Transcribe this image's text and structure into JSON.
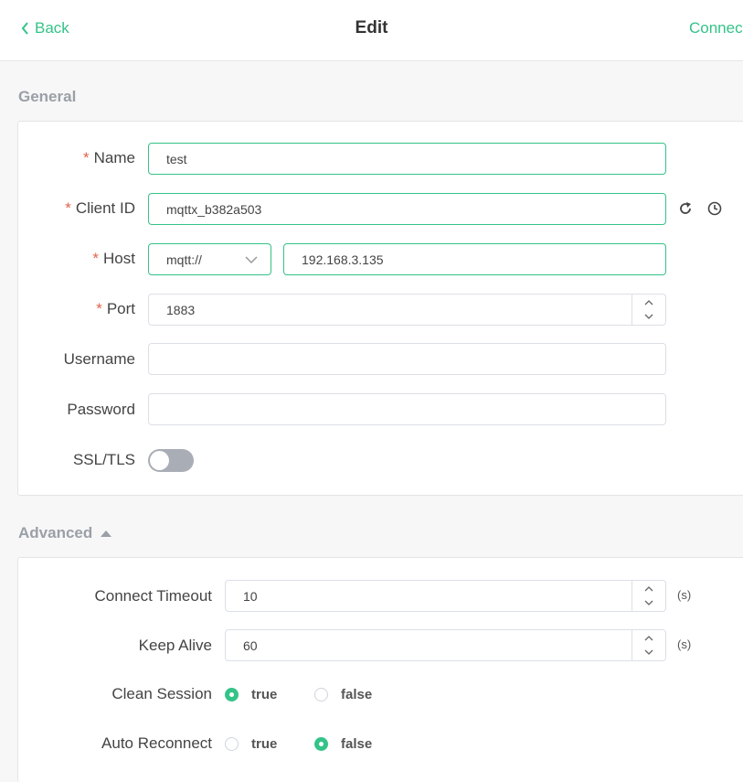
{
  "header": {
    "back_label": "Back",
    "title": "Edit",
    "connect_label": "Connect"
  },
  "general": {
    "section_title": "General",
    "name": {
      "label": "Name",
      "required_mark": "*",
      "value": "test"
    },
    "client_id": {
      "label": "Client ID",
      "required_mark": "*",
      "value": "mqttx_b382a503",
      "refresh_icon": "refresh-icon",
      "time_icon": "clock-icon"
    },
    "host": {
      "label": "Host",
      "required_mark": "*",
      "protocol": "mqtt://",
      "value": "192.168.3.135"
    },
    "port": {
      "label": "Port",
      "required_mark": "*",
      "value": "1883"
    },
    "username": {
      "label": "Username",
      "value": ""
    },
    "password": {
      "label": "Password",
      "value": ""
    },
    "ssl": {
      "label": "SSL/TLS",
      "enabled": false
    }
  },
  "advanced": {
    "section_title": "Advanced",
    "connect_timeout": {
      "label": "Connect Timeout",
      "value": "10",
      "unit": "(s)"
    },
    "keep_alive": {
      "label": "Keep Alive",
      "value": "60",
      "unit": "(s)"
    },
    "clean_session": {
      "label": "Clean Session",
      "options": [
        "true",
        "false"
      ],
      "selected": "true"
    },
    "auto_reconnect": {
      "label": "Auto Reconnect",
      "options": [
        "true",
        "false"
      ],
      "selected": "false"
    }
  },
  "colors": {
    "accent": "#34c388",
    "required": "#e4624c",
    "toggle_off": "#a9adb5"
  }
}
